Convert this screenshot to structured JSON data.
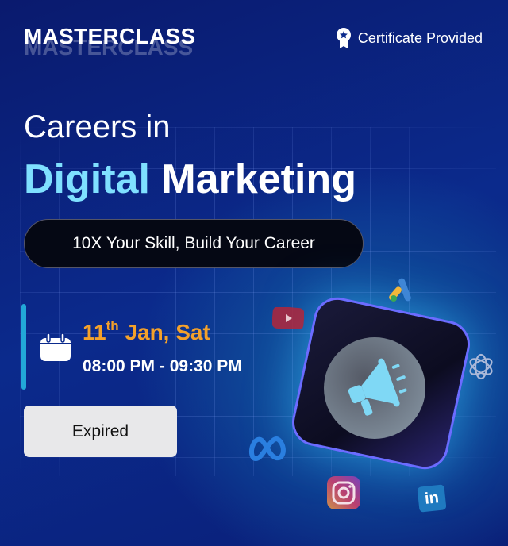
{
  "brand": {
    "title": "MASTERCLASS"
  },
  "certificate": {
    "label": "Certificate Provided",
    "icon": "award-badge-icon"
  },
  "headline": {
    "line1": "Careers in",
    "accent": "Digital",
    "rest": " Marketing"
  },
  "tagline": "10X Your Skill, Build Your Career",
  "schedule": {
    "day": "11",
    "suffix": "th",
    "date_rest": " Jan, Sat",
    "time": "08:00 PM - 09:30 PM",
    "icon": "calendar-icon"
  },
  "button": {
    "label": "Expired"
  },
  "colors": {
    "accent": "#7fe0ff",
    "date": "#f4a12a",
    "background": "#0b2a8c"
  },
  "icons": [
    "megaphone-icon",
    "youtube-icon",
    "google-ads-icon",
    "openai-icon",
    "meta-icon",
    "instagram-icon",
    "linkedin-icon"
  ],
  "linkedin_text": "in"
}
